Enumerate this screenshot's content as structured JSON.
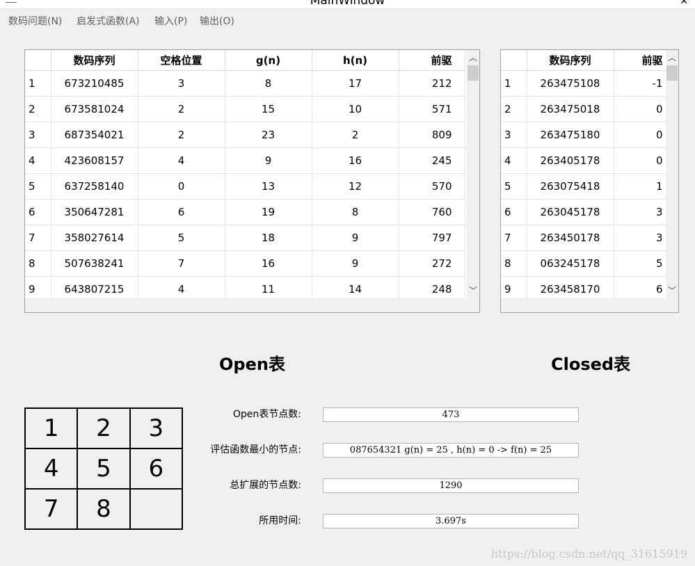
{
  "window": {
    "title": "MainWindow"
  },
  "menu": [
    {
      "label": "数码问题(N)"
    },
    {
      "label": "启发式函数(A)"
    },
    {
      "label": "输入(P)"
    },
    {
      "label": "输出(O)"
    }
  ],
  "open_table": {
    "headers": [
      "",
      "数码序列",
      "空格位置",
      "g(n)",
      "h(n)",
      "前驱"
    ],
    "rows": [
      [
        "1",
        "673210485",
        "3",
        "8",
        "17",
        "212"
      ],
      [
        "2",
        "673581024",
        "2",
        "15",
        "10",
        "571"
      ],
      [
        "3",
        "687354021",
        "2",
        "23",
        "2",
        "809"
      ],
      [
        "4",
        "423608157",
        "4",
        "9",
        "16",
        "245"
      ],
      [
        "5",
        "637258140",
        "0",
        "13",
        "12",
        "570"
      ],
      [
        "6",
        "350647281",
        "6",
        "19",
        "8",
        "760"
      ],
      [
        "7",
        "358027614",
        "5",
        "18",
        "9",
        "797"
      ],
      [
        "8",
        "507638241",
        "7",
        "16",
        "9",
        "272"
      ],
      [
        "9",
        "643807215",
        "4",
        "11",
        "14",
        "248"
      ]
    ]
  },
  "closed_table": {
    "headers": [
      "",
      "数码序列",
      "前驱"
    ],
    "rows": [
      [
        "1",
        "263475108",
        "-1"
      ],
      [
        "2",
        "263475018",
        "0"
      ],
      [
        "3",
        "263475180",
        "0"
      ],
      [
        "4",
        "263405178",
        "0"
      ],
      [
        "5",
        "263075418",
        "1"
      ],
      [
        "6",
        "263045178",
        "3"
      ],
      [
        "7",
        "263450178",
        "3"
      ],
      [
        "8",
        "063245178",
        "5"
      ],
      [
        "9",
        "263458170",
        "6"
      ]
    ]
  },
  "captions": {
    "open": "Open表",
    "closed": "Closed表"
  },
  "puzzle": [
    "1",
    "2",
    "3",
    "4",
    "5",
    "6",
    "7",
    "8",
    ""
  ],
  "fields": [
    {
      "label": "Open表节点数:",
      "value": "473"
    },
    {
      "label": "评估函数最小的节点:",
      "value": "087654321 g(n) = 25 , h(n) = 0 -> f(n) = 25"
    },
    {
      "label": "总扩展的节点数:",
      "value": "1290"
    },
    {
      "label": "所用时间:",
      "value": "3.697s"
    }
  ],
  "watermark": "https://blog.csdn.net/qq_31615919",
  "icons": {
    "scroll_up": "chevron-up-icon",
    "scroll_down": "chevron-down-icon"
  }
}
